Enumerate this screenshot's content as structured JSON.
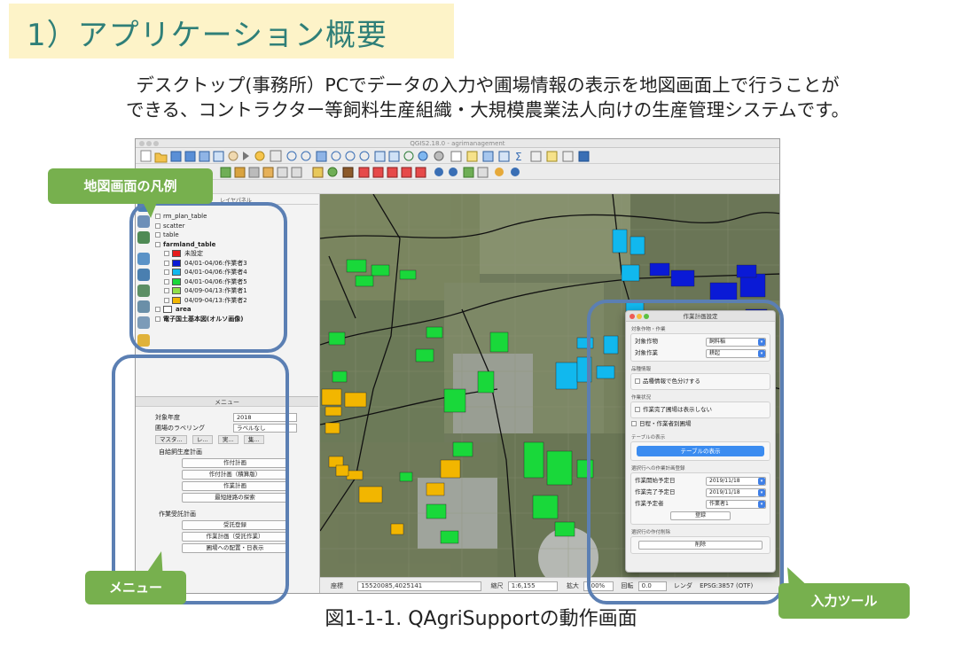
{
  "slide": {
    "title": "1）アプリケーション概要",
    "intro_line1": "デスクトップ(事務所）PCでデータの入力や圃場情報の表示を地図画面上で行うことが",
    "intro_line2": "できる、コントラクター等飼料生産組織・大規模農業法人向けの生産管理システムです。",
    "caption": "図1-1-1. QAgriSupportの動作画面"
  },
  "callouts": {
    "legend": "地図画面の凡例",
    "menu": "メニュー",
    "input_tool": "入力ツール"
  },
  "app": {
    "window_title": "QGIS2.18.0 - agrimanagement",
    "layer_panel_title": "レイヤパネル",
    "layers": [
      {
        "label": "rm_plan_table"
      },
      {
        "label": "scatter"
      },
      {
        "label": "table"
      },
      {
        "label": "farmland_table"
      }
    ],
    "legend_items": [
      {
        "label": "未設定",
        "color": "#e61b1b"
      },
      {
        "label": "04/01-04/06:作業者3",
        "color": "#0a1ad6"
      },
      {
        "label": "04/01-04/06:作業者4",
        "color": "#11b8ee"
      },
      {
        "label": "04/01-04/06:作業者5",
        "color": "#19d83a"
      },
      {
        "label": "04/09-04/13:作業者1",
        "color": "#8fe04a"
      },
      {
        "label": "04/09-04/13:作業者2",
        "color": "#f2b600"
      }
    ],
    "area_label": "area",
    "base_layer": "電子国土基本図(オルソ画像)",
    "menu_panel_title": "メニュー",
    "menu": {
      "year_label": "対象年度",
      "year_value": "2018",
      "labeling_label": "圃場のラベリング",
      "labeling_value": "ラベルなし",
      "tabs": [
        "マスタ...",
        "レ...",
        "実...",
        "集..."
      ],
      "group1_title": "自給飼生産計画",
      "group1_buttons": [
        "作付計画",
        "作付計画（積算版）",
        "作業計画",
        "最短経路の探索"
      ],
      "group2_title": "作業受託計画",
      "group2_buttons": [
        "受託登録",
        "作業計画（受託作業）",
        "圃場への配置・日表示"
      ]
    },
    "status": {
      "coord_label": "座標",
      "coord_value": "15520085,4025141",
      "scale_label": "縮尺",
      "scale_value": "1:6,155",
      "zoom_label": "拡大",
      "zoom_value": "100%",
      "rotation_label": "回転",
      "rotation_value": "0.0",
      "render_label": "レンダ",
      "crs": "EPSG:3857 (OTF)"
    },
    "dialog": {
      "title": "作業計画設定",
      "section_target": "対象作物・作業",
      "crop_label": "対象作物",
      "crop_value": "飼料稲",
      "work_label": "対象作業",
      "work_value": "耕起",
      "section_variety": "品種情報",
      "variety_check": "品種情報で色分けする",
      "section_status": "作業状況",
      "status_check": "作業完了圃場は表示しない",
      "date_check": "日程・作業者別圃場",
      "section_table": "テーブルの表示",
      "table_button": "テーブルの表示",
      "section_register": "選択行への作業計画登録",
      "start_label": "作業開始予定日",
      "start_value": "2019/11/18",
      "end_label": "作業完了予定日",
      "end_value": "2019/11/18",
      "worker_label": "作業予定者",
      "worker_value": "作業者1",
      "register_button": "登録",
      "section_delete": "選択行の作付削除",
      "delete_button": "削除"
    }
  }
}
